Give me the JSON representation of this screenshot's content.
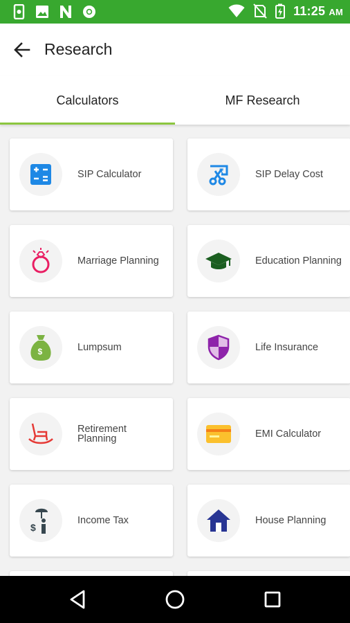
{
  "status_bar": {
    "time": "11:25",
    "ampm": "AM",
    "icons": [
      "phone-icon",
      "image-icon",
      "n-icon",
      "chrome-icon",
      "wifi-icon",
      "no-sim-icon",
      "battery-charging-icon"
    ]
  },
  "app_bar": {
    "title": "Research"
  },
  "tabs": [
    {
      "label": "Calculators",
      "active": true
    },
    {
      "label": "MF Research",
      "active": false
    }
  ],
  "cards": [
    {
      "label": "SIP Calculator",
      "icon": "calculator-icon",
      "color": "#1e88e5"
    },
    {
      "label": "SIP Delay Cost",
      "icon": "delay-cost-icon",
      "color": "#1e88e5"
    },
    {
      "label": "Marriage Planning",
      "icon": "ring-icon",
      "color": "#e91e63"
    },
    {
      "label": "Education Planning",
      "icon": "graduation-cap-icon",
      "color": "#1b5e20"
    },
    {
      "label": "Lumpsum",
      "icon": "money-bag-icon",
      "color": "#7cb342"
    },
    {
      "label": "Life Insurance",
      "icon": "shield-icon",
      "color": "#8e24aa"
    },
    {
      "label": "Retirement Planning",
      "icon": "rocking-chair-icon",
      "color": "#e53935"
    },
    {
      "label": "EMI Calculator",
      "icon": "card-icon",
      "color": "#fbc02d"
    },
    {
      "label": "Income Tax",
      "icon": "income-tax-icon",
      "color": "#37474f"
    },
    {
      "label": "House Planning",
      "icon": "house-icon",
      "color": "#283593"
    }
  ]
}
